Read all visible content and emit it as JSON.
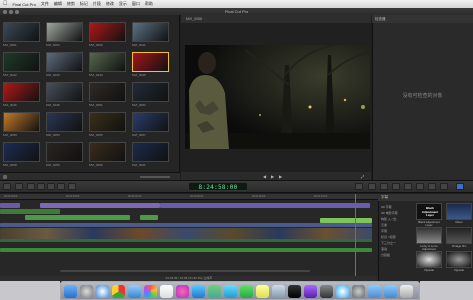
{
  "menubar": {
    "items": [
      "Final Cut Pro",
      "文件",
      "编辑",
      "修剪",
      "标记",
      "片段",
      "修改",
      "显示",
      "窗口",
      "帮助"
    ]
  },
  "window": {
    "title": "Final Cut Pro"
  },
  "browser": {
    "clips": [
      {
        "name": "MVI_0001",
        "tone": "#3b4a55"
      },
      {
        "name": "MVI_0003",
        "tone": "#9fa6a0"
      },
      {
        "name": "MVI_0033",
        "tone": "#b01818"
      },
      {
        "name": "MVI_0041",
        "tone": "#5c7384"
      },
      {
        "name": "MVI_0042",
        "tone": "#1f3a2a"
      },
      {
        "name": "MVI_0043",
        "tone": "#5e6b7c"
      },
      {
        "name": "MVI_0044",
        "tone": "#56674e"
      },
      {
        "name": "MVI_0045",
        "tone": "#a4151a"
      },
      {
        "name": "MVI_0046",
        "tone": "#b01818"
      },
      {
        "name": "MVI_0049",
        "tone": "#47505c"
      },
      {
        "name": "MVI_0051",
        "tone": "#2f2a26"
      },
      {
        "name": "MVI_0052",
        "tone": "#232a36"
      },
      {
        "name": "MVI_0053",
        "tone": "#c07a2a"
      },
      {
        "name": "MVI_0054",
        "tone": "#2a3654"
      },
      {
        "name": "MVI_0056",
        "tone": "#3a3018"
      },
      {
        "name": "MVI_0057",
        "tone": "#2a3e6c"
      },
      {
        "name": "MVI_0058",
        "tone": "#1e2c52"
      },
      {
        "name": "MVI_0059",
        "tone": "#2a2420"
      },
      {
        "name": "MVI_0060",
        "tone": "#3a2c1c"
      },
      {
        "name": "MVI_0061",
        "tone": "#1c2a4c"
      }
    ],
    "selected_index": 7
  },
  "viewer": {
    "clip_name": "MVI_0058"
  },
  "inspector": {
    "title": "检查器",
    "empty_text": "没有可检查的对象"
  },
  "toolbar": {
    "timecode": "8:24:58:00"
  },
  "timeline": {
    "ruler": [
      "00:00:00:00",
      "00:00:15:00",
      "00:00:30:00",
      "00:00:45:00",
      "00:01:00:00",
      "00:01:15:00"
    ],
    "footer": "01:02:06 / 01:05:15 HD 25p 立体声"
  },
  "generators": {
    "header": "字幕",
    "categories": [
      "3D 字幕",
      "3D 电影字幕",
      "构建 入 / 出",
      "元素",
      "字幕",
      "标识 / 标题",
      "下三分之一",
      "滚动",
      "分镜板"
    ],
    "items": [
      {
        "label": "Black Adjustment Layer",
        "caption": "Black Adjustment Layer"
      },
      {
        "label": "",
        "caption": "Moon"
      },
      {
        "label": "",
        "caption": "Lucky & Lomo Adjustment"
      },
      {
        "label": "",
        "caption": "Vintage film"
      },
      {
        "label": "",
        "caption": "Vignette"
      },
      {
        "label": "",
        "caption": "Vignette"
      }
    ]
  }
}
